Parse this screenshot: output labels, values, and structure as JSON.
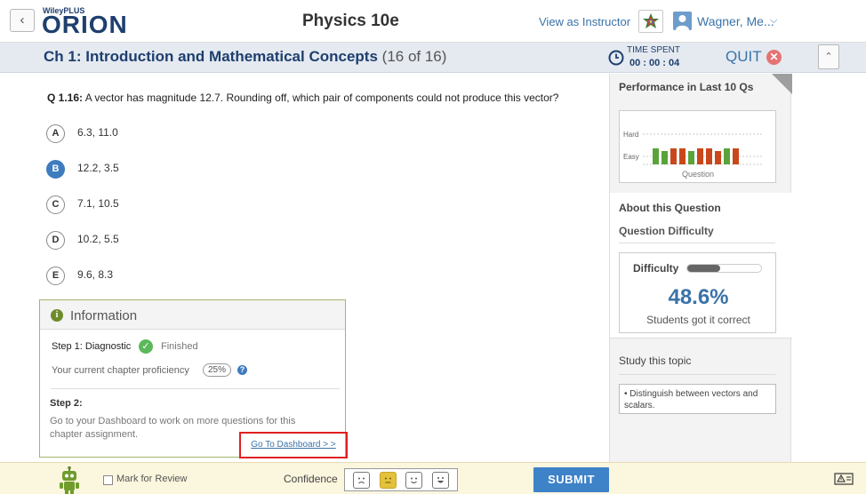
{
  "header": {
    "brand_small": "WileyPLUS",
    "brand_big": "ORION",
    "title": "Physics 10e",
    "view_as_instructor": "View as Instructor",
    "user_name": "Wagner, Me...",
    "back_icon": "chevron-left-icon",
    "menu_icon": "chevron-down-icon"
  },
  "chapter": {
    "title": "Ch 1: Introduction and Mathematical Concepts",
    "count": "(16 of 16)",
    "time_label": "TIME SPENT",
    "time_value": "00 : 00 : 04",
    "quit_label": "QUIT",
    "quit_icon": "x"
  },
  "question": {
    "number": "Q 1.16:",
    "text": "A vector has magnitude 12.7. Rounding off, which pair of components could not produce this vector?",
    "choices": [
      {
        "letter": "A",
        "text": "6.3, 11.0",
        "selected": false
      },
      {
        "letter": "B",
        "text": "12.2, 3.5",
        "selected": true
      },
      {
        "letter": "C",
        "text": "7.1, 10.5",
        "selected": false
      },
      {
        "letter": "D",
        "text": "10.2, 5.5",
        "selected": false
      },
      {
        "letter": "E",
        "text": "9.6, 8.3",
        "selected": false
      }
    ]
  },
  "info": {
    "title": "Information",
    "info_icon": "i",
    "step1_label": "Step 1: Diagnostic",
    "step1_status": "Finished",
    "proficiency_label": "Your current chapter proficiency",
    "proficiency_value": "25%",
    "help_icon": "?",
    "step2_label": "Step 2:",
    "step2_text": "Go to your Dashboard to work on more questions for this chapter assignment.",
    "dashboard_link": "Go To Dashboard > >"
  },
  "right_panel": {
    "performance_title": "Performance in Last 10 Qs",
    "about_title": "About this Question",
    "difficulty_heading": "Question Difficulty",
    "difficulty_label": "Difficulty",
    "difficulty_level": 0.45,
    "percent": "48.6%",
    "percent_caption": "Students got it correct",
    "study_title": "Study this topic",
    "study_item": "• Distinguish between vectors and scalars."
  },
  "chart_data": {
    "type": "bar",
    "title": "",
    "xlabel": "Question",
    "ylabel": "",
    "y_categories": [
      "Easy",
      "Hard"
    ],
    "colors": {
      "green": "#5aa33a",
      "red": "#c8481b"
    },
    "bars": [
      {
        "level": "Easy",
        "color": "green"
      },
      {
        "level": "Easy",
        "color": "green"
      },
      {
        "level": "Easy",
        "color": "red"
      },
      {
        "level": "Easy",
        "color": "red"
      },
      {
        "level": "Easy",
        "color": "green"
      },
      {
        "level": "Easy",
        "color": "red"
      },
      {
        "level": "Easy",
        "color": "red"
      },
      {
        "level": "Easy",
        "color": "red"
      },
      {
        "level": "Easy",
        "color": "green"
      },
      {
        "level": "Easy",
        "color": "red"
      }
    ]
  },
  "bottom": {
    "mark_for_review": "Mark for Review",
    "confidence_label": "Confidence",
    "confidence_options": [
      "sad",
      "neutral",
      "happy",
      "very-happy"
    ],
    "confidence_selected": "neutral",
    "submit_label": "SUBMIT"
  },
  "colors": {
    "brand_blue": "#1e3f6e",
    "link_blue": "#3a73a8",
    "submit_blue": "#3e82c8",
    "highlight_red": "#e02020"
  }
}
